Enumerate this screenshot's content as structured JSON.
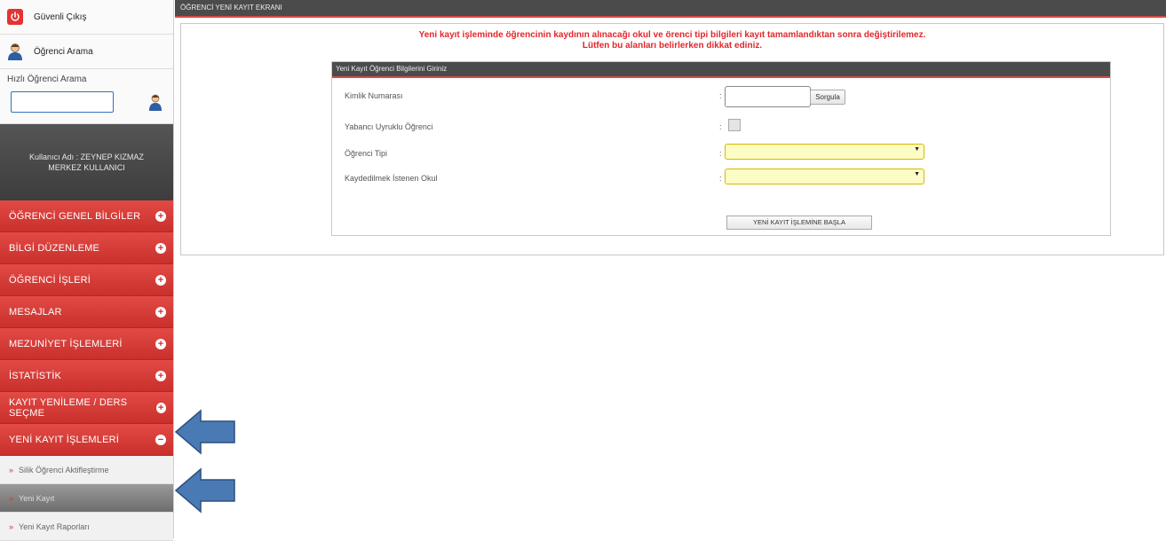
{
  "sidebar": {
    "logout_label": "Güvenli Çıkış",
    "student_search_label": "Öğrenci Arama",
    "quick_search_title": "Hızlı Öğrenci Arama",
    "quick_search_value": "",
    "user_line1": "Kullanıcı Adı : ZEYNEP KIZMAZ",
    "user_line2": "MERKEZ KULLANICI",
    "menu": [
      {
        "label": "ÖĞRENCİ GENEL BİLGİLER",
        "icon": "plus-circle-icon"
      },
      {
        "label": "BİLGİ DÜZENLEME",
        "icon": "plus-circle-icon"
      },
      {
        "label": "ÖĞRENCİ İŞLERİ",
        "icon": "plus-circle-icon"
      },
      {
        "label": "MESAJLAR",
        "icon": "plus-circle-icon"
      },
      {
        "label": "MEZUNİYET İŞLEMLERİ",
        "icon": "plus-circle-icon"
      },
      {
        "label": "İSTATİSTİK",
        "icon": "plus-circle-icon"
      },
      {
        "label": "KAYIT YENİLEME / DERS SEÇME",
        "icon": "plus-circle-icon"
      },
      {
        "label": "YENİ KAYIT İŞLEMLERİ",
        "icon": "minus-circle-icon"
      }
    ],
    "submenu": [
      {
        "label": "Silik Öğrenci Aktifleştirme",
        "active": false
      },
      {
        "label": "Yeni Kayıt",
        "active": true
      },
      {
        "label": "Yeni Kayıt Raporları",
        "active": false
      }
    ]
  },
  "header": {
    "title": "ÖĞRENCİ YENİ KAYIT EKRANI"
  },
  "warning": {
    "line1": "Yeni kayıt işleminde öğrencinin kaydının alınacağı okul ve örenci tipi bilgileri kayıt tamamlandıktan sonra değiştirilemez.",
    "line2": "Lütfen bu alanları belirlerken dikkat ediniz."
  },
  "form": {
    "title": "Yeni Kayıt Öğrenci Bilgilerini Giriniz",
    "colon": ":",
    "fields": [
      {
        "label": "Kimlik Numarası",
        "value": ""
      },
      {
        "label": "Yabancı Uyruklu Öğrenci",
        "checked": false
      },
      {
        "label": "Öğrenci Tipi",
        "selected": ""
      },
      {
        "label": "Kaydedilmek İstenen Okul",
        "selected": ""
      }
    ],
    "query_button": "Sorgula",
    "dropdown_arrow": "▼",
    "start_button": "YENİ KAYIT İŞLEMİNE BAŞLA"
  },
  "colors": {
    "menu_red": "#c9302c",
    "warning_red": "#e2262b",
    "header_dark": "#4b4b4b",
    "select_yellow": "#fcfcc4",
    "arrow_blue": "#4a7ab4"
  }
}
